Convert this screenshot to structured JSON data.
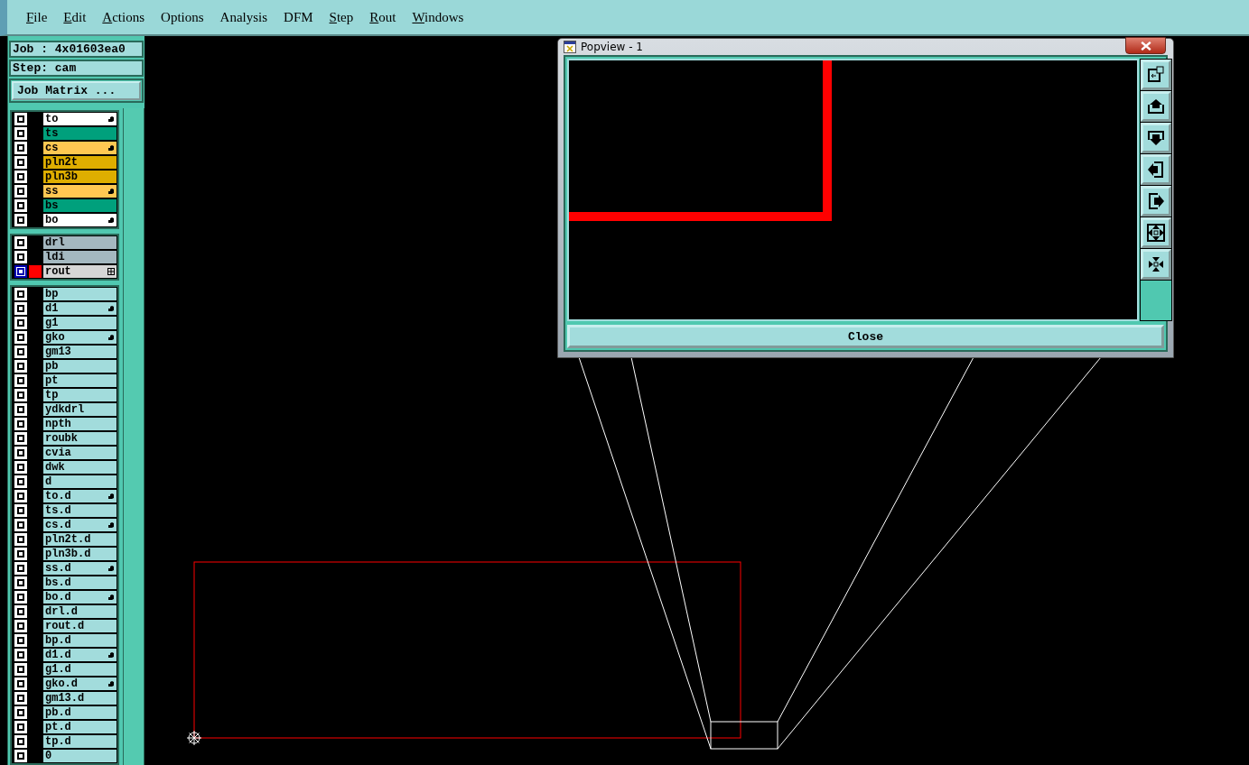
{
  "menu": [
    {
      "label": "File",
      "mnemonic": true
    },
    {
      "label": "Edit",
      "mnemonic": true
    },
    {
      "label": "Actions",
      "mnemonic": true
    },
    {
      "label": "Options",
      "mnemonic": false
    },
    {
      "label": "Analysis",
      "mnemonic": false
    },
    {
      "label": "DFM",
      "mnemonic": false
    },
    {
      "label": "Step",
      "mnemonic": true
    },
    {
      "label": "Rout",
      "mnemonic": true
    },
    {
      "label": "Windows",
      "mnemonic": true
    }
  ],
  "job": "Job : 4x01603ea0",
  "step": "Step: cam",
  "job_matrix_button": "Job Matrix ...",
  "layer_groups": [
    [
      {
        "name": "to",
        "color": "#ffffff",
        "kind": "pointer",
        "selected": false
      },
      {
        "name": "ts",
        "color": "#00a07c",
        "kind": "plain",
        "selected": false
      },
      {
        "name": "cs",
        "color": "#ffc852",
        "kind": "pointer",
        "selected": false
      },
      {
        "name": "pln2t",
        "color": "#deae00",
        "kind": "plain",
        "selected": false
      },
      {
        "name": "pln3b",
        "color": "#deae00",
        "kind": "plain",
        "selected": false
      },
      {
        "name": "ss",
        "color": "#ffc852",
        "kind": "pointer",
        "selected": false
      },
      {
        "name": "bs",
        "color": "#00a07c",
        "kind": "plain",
        "selected": false
      },
      {
        "name": "bo",
        "color": "#ffffff",
        "kind": "pointer",
        "selected": false
      }
    ],
    [
      {
        "name": "drl",
        "color": "#a4b8c0",
        "kind": "plain",
        "selected": false
      },
      {
        "name": "ldi",
        "color": "#a4b8c0",
        "kind": "plain",
        "selected": false
      },
      {
        "name": "rout",
        "color": "#d6d6d6",
        "kind": "grid",
        "selected": true
      }
    ],
    [
      {
        "name": "bp",
        "color": "#a2dcdc",
        "kind": "plain",
        "selected": false
      },
      {
        "name": "d1",
        "color": "#a2dcdc",
        "kind": "pointer",
        "selected": false
      },
      {
        "name": "g1",
        "color": "#a2dcdc",
        "kind": "plain",
        "selected": false
      },
      {
        "name": "gko",
        "color": "#a2dcdc",
        "kind": "pointer",
        "selected": false
      },
      {
        "name": "gm13",
        "color": "#a2dcdc",
        "kind": "plain",
        "selected": false
      },
      {
        "name": "pb",
        "color": "#a2dcdc",
        "kind": "plain",
        "selected": false
      },
      {
        "name": "pt",
        "color": "#a2dcdc",
        "kind": "plain",
        "selected": false
      },
      {
        "name": "tp",
        "color": "#a2dcdc",
        "kind": "plain",
        "selected": false
      },
      {
        "name": "ydkdrl",
        "color": "#a2dcdc",
        "kind": "plain",
        "selected": false
      },
      {
        "name": "npth",
        "color": "#a2dcdc",
        "kind": "plain",
        "selected": false
      },
      {
        "name": "roubk",
        "color": "#a2dcdc",
        "kind": "plain",
        "selected": false
      },
      {
        "name": "cvia",
        "color": "#a2dcdc",
        "kind": "plain",
        "selected": false
      },
      {
        "name": "dwk",
        "color": "#a2dcdc",
        "kind": "plain",
        "selected": false
      },
      {
        "name": "d",
        "color": "#a2dcdc",
        "kind": "plain",
        "selected": false
      },
      {
        "name": "to.d",
        "color": "#a2dcdc",
        "kind": "pointer",
        "selected": false
      },
      {
        "name": "ts.d",
        "color": "#a2dcdc",
        "kind": "plain",
        "selected": false
      },
      {
        "name": "cs.d",
        "color": "#a2dcdc",
        "kind": "pointer",
        "selected": false
      },
      {
        "name": "pln2t.d",
        "color": "#a2dcdc",
        "kind": "plain",
        "selected": false
      },
      {
        "name": "pln3b.d",
        "color": "#a2dcdc",
        "kind": "plain",
        "selected": false
      },
      {
        "name": "ss.d",
        "color": "#a2dcdc",
        "kind": "pointer",
        "selected": false
      },
      {
        "name": "bs.d",
        "color": "#a2dcdc",
        "kind": "plain",
        "selected": false
      },
      {
        "name": "bo.d",
        "color": "#a2dcdc",
        "kind": "pointer",
        "selected": false
      },
      {
        "name": "drl.d",
        "color": "#a2dcdc",
        "kind": "plain",
        "selected": false
      },
      {
        "name": "rout.d",
        "color": "#a2dcdc",
        "kind": "plain",
        "selected": false
      },
      {
        "name": "bp.d",
        "color": "#a2dcdc",
        "kind": "plain",
        "selected": false
      },
      {
        "name": "d1.d",
        "color": "#a2dcdc",
        "kind": "pointer",
        "selected": false
      },
      {
        "name": "g1.d",
        "color": "#a2dcdc",
        "kind": "plain",
        "selected": false
      },
      {
        "name": "gko.d",
        "color": "#a2dcdc",
        "kind": "pointer",
        "selected": false
      },
      {
        "name": "gm13.d",
        "color": "#a2dcdc",
        "kind": "plain",
        "selected": false
      },
      {
        "name": "pb.d",
        "color": "#a2dcdc",
        "kind": "plain",
        "selected": false
      },
      {
        "name": "pt.d",
        "color": "#a2dcdc",
        "kind": "plain",
        "selected": false
      },
      {
        "name": "tp.d",
        "color": "#a2dcdc",
        "kind": "plain",
        "selected": false
      },
      {
        "name": "0",
        "color": "#a2dcdc",
        "kind": "plain",
        "selected": false
      }
    ]
  ],
  "popview": {
    "title": "Popview - 1",
    "tools": [
      {
        "kind": "fit"
      },
      {
        "kind": "up"
      },
      {
        "kind": "down"
      },
      {
        "kind": "left"
      },
      {
        "kind": "right"
      },
      {
        "kind": "zoom-in"
      },
      {
        "kind": "zoom-out"
      }
    ],
    "close_button": "Close"
  }
}
